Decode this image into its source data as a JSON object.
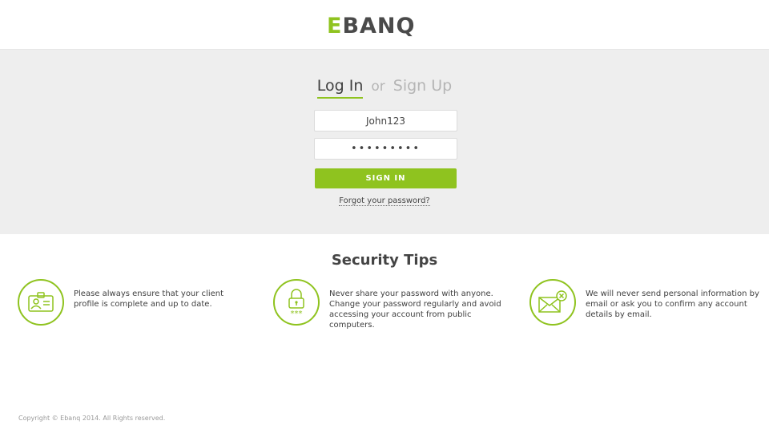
{
  "brand": {
    "logo_first": "E",
    "logo_rest": "BANQ",
    "accent_color": "#8fc31f"
  },
  "auth": {
    "tab_login": "Log In",
    "tab_or": "or",
    "tab_signup": "Sign Up",
    "username_value": "John123",
    "password_value": "•••••••••",
    "signin_label": "SIGN IN",
    "forgot_label": "Forgot your password?"
  },
  "tips": {
    "title": "Security Tips",
    "items": [
      {
        "icon": "id-card-icon",
        "text": "Please always ensure that your client profile is complete and up to date."
      },
      {
        "icon": "padlock-icon",
        "text": "Never share your password with anyone. Change your password regularly and avoid accessing your account from public computers."
      },
      {
        "icon": "envelope-blocked-icon",
        "text": "We will never send personal information by email or ask you to confirm any account details by email."
      }
    ]
  },
  "footer": {
    "copyright": "Copyright © Ebanq 2014. All Rights reserved."
  }
}
